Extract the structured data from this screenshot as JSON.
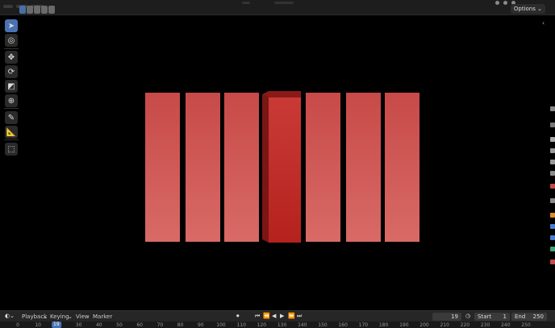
{
  "header": {
    "options_label": "Options",
    "options_chevron": "chevron-down-icon"
  },
  "toolbar": {
    "tools": [
      {
        "name": "select-box-tool",
        "glyph": "➤",
        "active": true
      },
      {
        "name": "cursor-tool",
        "glyph": "◎",
        "active": false
      },
      {
        "name": "move-tool",
        "glyph": "✥",
        "active": false
      },
      {
        "name": "rotate-tool",
        "glyph": "⟳",
        "active": false
      },
      {
        "name": "scale-tool",
        "glyph": "◩",
        "active": false
      },
      {
        "name": "transform-tool",
        "glyph": "⊕",
        "active": false
      },
      {
        "name": "annotate-tool",
        "glyph": "✎",
        "active": false
      },
      {
        "name": "measure-tool",
        "glyph": "📐",
        "active": false
      },
      {
        "name": "add-cube-tool",
        "glyph": "⬚",
        "active": false
      }
    ]
  },
  "scene": {
    "bar_color": "#c94848",
    "selected_color": "#b82a26"
  },
  "timeline": {
    "menus": [
      "Playback",
      "Keying",
      "View",
      "Marker"
    ],
    "current_frame": "19",
    "start_label": "Start",
    "start_value": "1",
    "end_label": "End",
    "end_value": "250",
    "ruler_ticks": [
      "0",
      "10",
      "19",
      "30",
      "40",
      "50",
      "60",
      "70",
      "80",
      "90",
      "100",
      "110",
      "120",
      "130",
      "140",
      "150",
      "160",
      "170",
      "180",
      "190",
      "200",
      "210",
      "220",
      "230",
      "240",
      "250"
    ]
  }
}
